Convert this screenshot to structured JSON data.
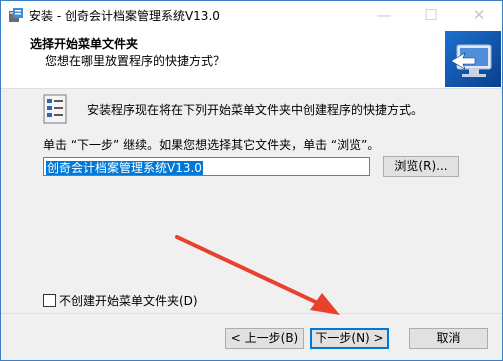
{
  "window": {
    "title": "安装 - 创奇会计档案管理系统V13.0"
  },
  "titlebar": {
    "minimize": "—",
    "maximize": "☐",
    "close": "✕"
  },
  "header": {
    "title": "选择开始菜单文件夹",
    "subtitle": "您想在哪里放置程序的快捷方式？"
  },
  "body": {
    "description": "安装程序现在将在下列开始菜单文件夹中创建程序的快捷方式。",
    "hint": "单击 “下一步” 继续。如果您想选择其它文件夹，单击 “浏览”。",
    "folder_value": "创奇会计档案管理系统V13.0",
    "browse_label": "浏览(R)...",
    "no_folder_checkbox_label": "不创建开始菜单文件夹(D)",
    "no_folder_checked": false
  },
  "footer": {
    "back_label": "< 上一步(B)",
    "next_label": "下一步(N) >",
    "cancel_label": "取消"
  },
  "colors": {
    "accent": "#0078d7",
    "arrow": "#e8412c",
    "window_border": "#3c7fc4"
  },
  "icons": {
    "app": "installer-app-icon",
    "header_logo": "monitor-shortcut-icon",
    "folder": "start-menu-folder-icon"
  }
}
